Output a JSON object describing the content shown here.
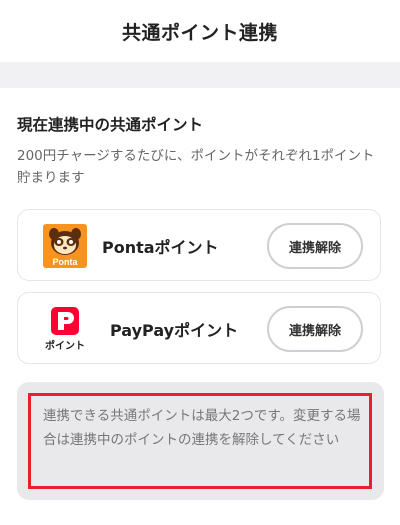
{
  "header": {
    "title": "共通ポイント連携"
  },
  "section": {
    "title": "現在連携中の共通ポイント",
    "description": "200円チャージするたびに、ポイントがそれぞれ1ポイント貯まります"
  },
  "points": [
    {
      "name": "Pontaポイント",
      "logo_text": "Ponta",
      "logo_color": "#f7931e",
      "button_label": "連携解除"
    },
    {
      "name": "PayPayポイント",
      "logo_text": "ポイント",
      "logo_color": "#ff0033",
      "button_label": "連携解除"
    }
  ],
  "notice": {
    "text": "連携できる共通ポイントは最大2つです。変更する場合は連携中のポイントの連携を解除してください",
    "highlight_color": "#e8202a"
  }
}
